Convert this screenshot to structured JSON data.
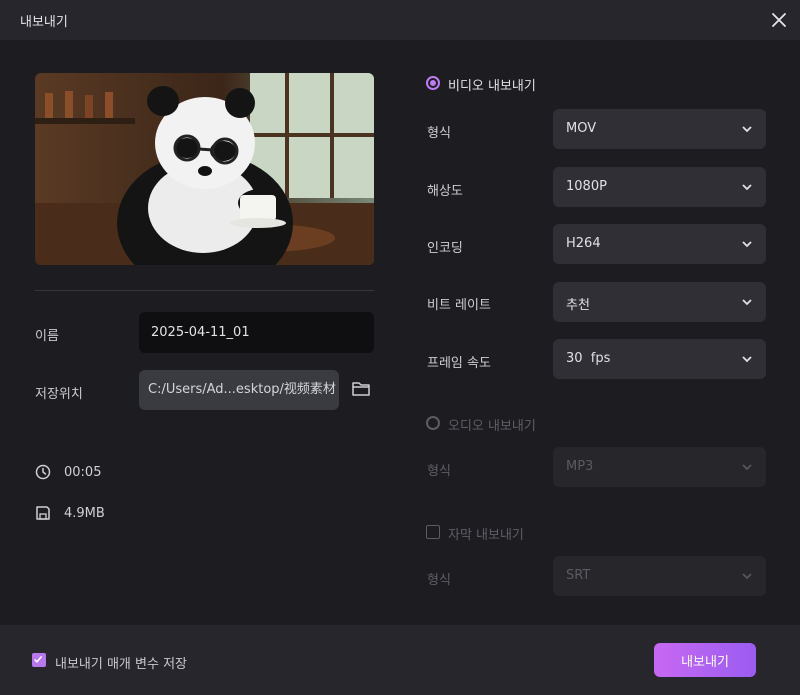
{
  "window": {
    "title": "내보내기"
  },
  "left": {
    "name_label": "이름",
    "name_value": "2025-04-11_01",
    "location_label": "저장위치",
    "location_value": "C:/Users/Ad...esktop/视频素材",
    "duration": "00:05",
    "file_size": "4.9MB"
  },
  "video": {
    "section_label": "비디오 내보내기",
    "selected": true,
    "format_label": "형식",
    "format_value": "MOV",
    "resolution_label": "해상도",
    "resolution_value": "1080P",
    "encoding_label": "인코딩",
    "encoding_value": "H264",
    "bitrate_label": "비트 레이트",
    "bitrate_value": "추천",
    "framerate_label": "프레임 속도",
    "framerate_value": "30  fps"
  },
  "audio": {
    "section_label": "오디오 내보내기",
    "selected": false,
    "format_label": "형식",
    "format_value": "MP3"
  },
  "subtitle": {
    "section_label": "자막 내보내기",
    "checked": false,
    "format_label": "형식",
    "format_value": "SRT"
  },
  "footer": {
    "save_params_label": "내보내기 매개 변수 저장",
    "save_params_checked": true,
    "export_button": "내보내기"
  },
  "colors": {
    "accent": "#bf7cf2",
    "button_gradient_start": "#c769f2",
    "button_gradient_end": "#9a5cf0",
    "background": "#1c1c21"
  }
}
